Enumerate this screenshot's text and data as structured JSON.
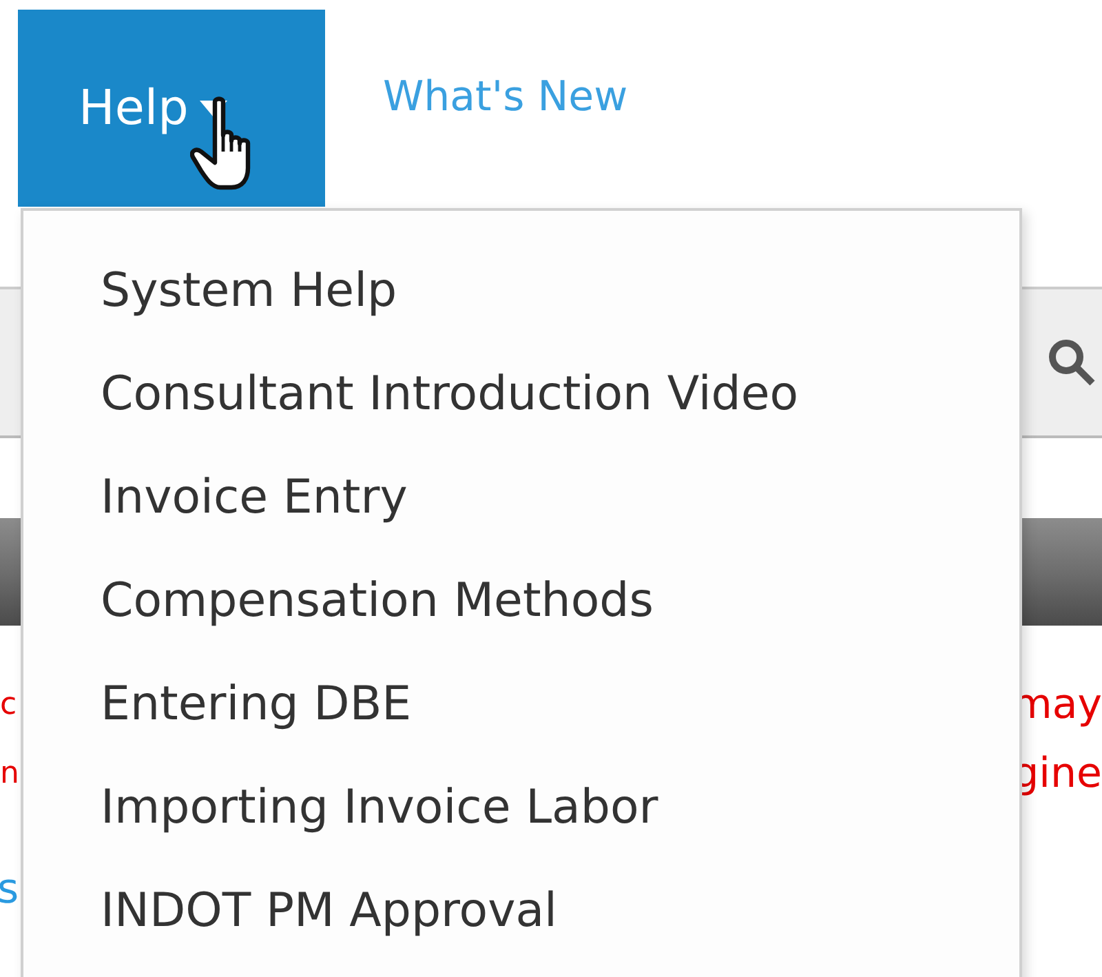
{
  "nav": [
    {
      "label": "Help",
      "kind": "dropdown",
      "selected": true
    },
    {
      "label": "What's New",
      "kind": "link",
      "selected": false
    }
  ],
  "help_menu": {
    "expanded": true,
    "items": [
      "System Help",
      "Consultant Introduction Video",
      "Invoice Entry",
      "Compensation Methods",
      "Entering DBE",
      "Importing Invoice Labor",
      "INDOT PM Approval"
    ]
  },
  "notice_lines": [
    {
      "left": "c",
      "right": "may"
    },
    {
      "left": "n",
      "right": "gine"
    }
  ],
  "link_fragment": "s"
}
